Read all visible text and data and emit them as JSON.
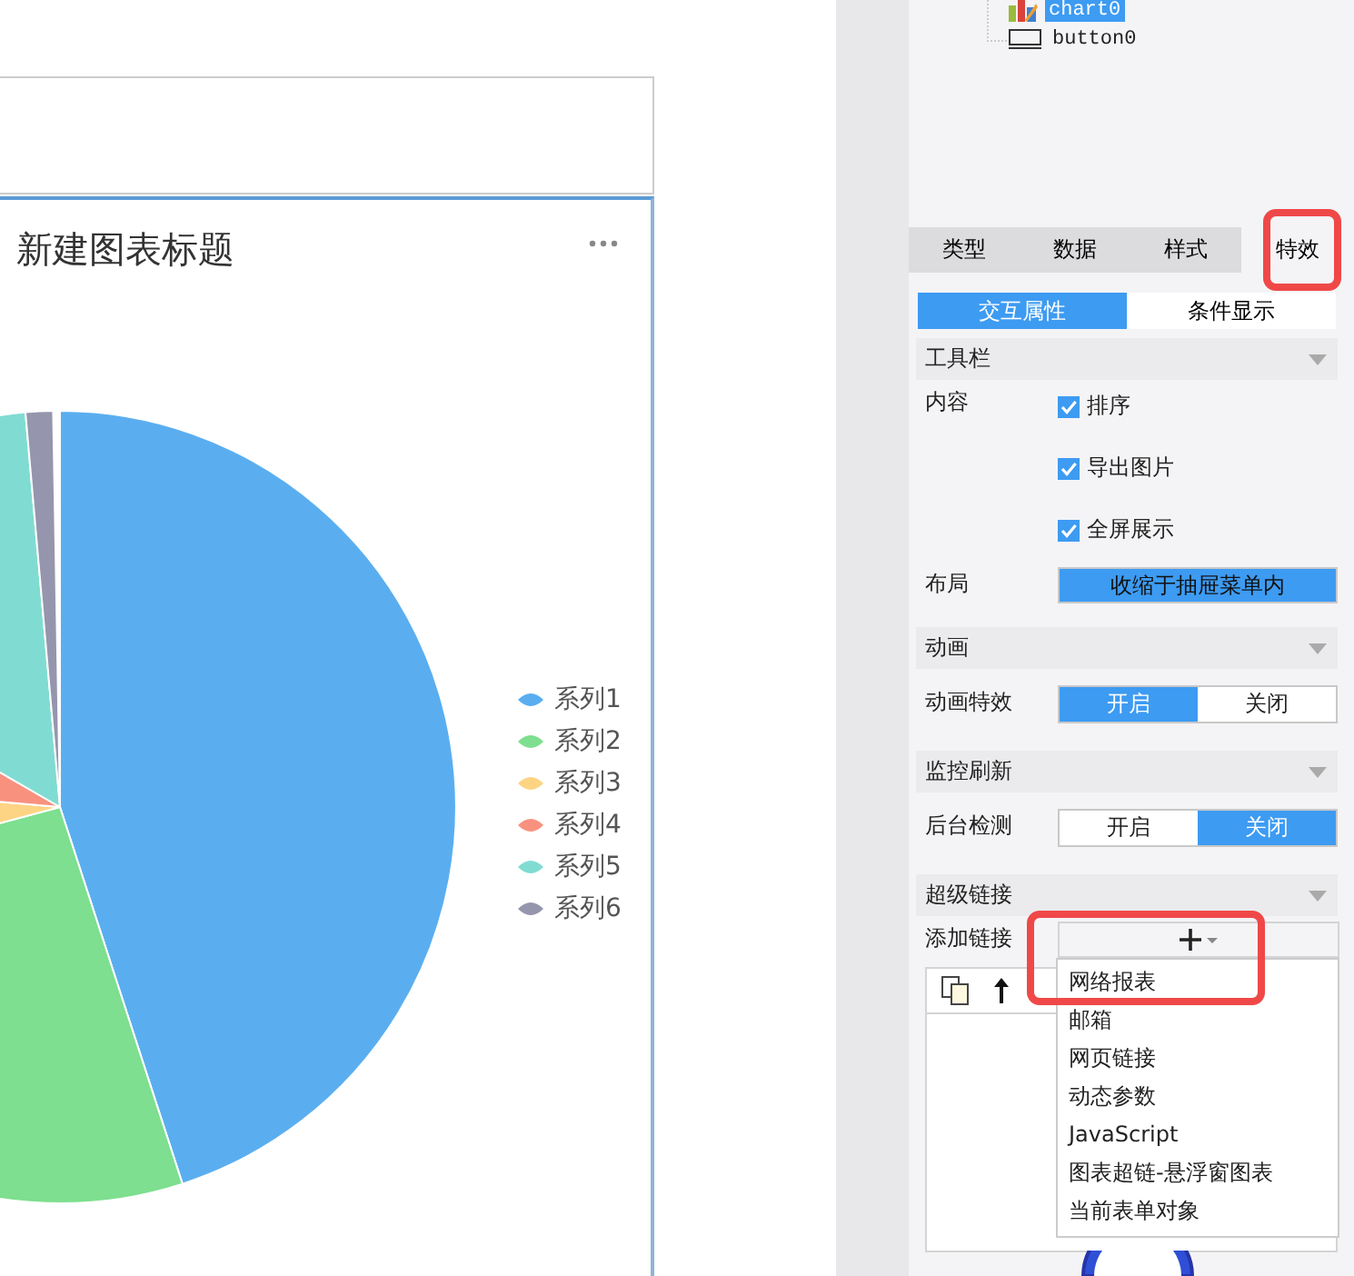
{
  "tree": [
    {
      "label": "chart0",
      "selected": true
    },
    {
      "label": "button0",
      "selected": false
    }
  ],
  "chart": {
    "title": "新建图表标题",
    "legend": [
      {
        "name": "系列1",
        "color": "#5aaef0"
      },
      {
        "name": "系列2",
        "color": "#7ddf8f"
      },
      {
        "name": "系列3",
        "color": "#fdd484"
      },
      {
        "name": "系列4",
        "color": "#f9917f"
      },
      {
        "name": "系列5",
        "color": "#80dcd2"
      },
      {
        "name": "系列6",
        "color": "#9595ad"
      }
    ]
  },
  "tabs": [
    {
      "label": "类型",
      "selected": false
    },
    {
      "label": "数据",
      "selected": false
    },
    {
      "label": "样式",
      "selected": false
    },
    {
      "label": "特效",
      "selected": true
    }
  ],
  "subtabs": [
    {
      "label": "交互属性",
      "selected": true
    },
    {
      "label": "条件显示",
      "selected": false
    }
  ],
  "sections": [
    {
      "title": "工具栏",
      "rows": [
        {
          "kind": "checks",
          "label": "内容",
          "options": [
            {
              "label": "排序",
              "checked": true
            },
            {
              "label": "导出图片",
              "checked": true
            },
            {
              "label": "全屏展示",
              "checked": true
            }
          ]
        },
        {
          "kind": "button",
          "label": "布局",
          "value": "收缩于抽屉菜单内"
        }
      ]
    },
    {
      "title": "动画",
      "rows": [
        {
          "kind": "toggle",
          "label": "动画特效",
          "options": [
            {
              "label": "开启",
              "selected": true
            },
            {
              "label": "关闭",
              "selected": false
            }
          ]
        }
      ]
    },
    {
      "title": "监控刷新",
      "rows": [
        {
          "kind": "toggle",
          "label": "后台检测",
          "options": [
            {
              "label": "开启",
              "selected": false
            },
            {
              "label": "关闭",
              "selected": true
            }
          ]
        }
      ]
    },
    {
      "title": "超级链接",
      "rows": [
        {
          "kind": "links",
          "label": "添加链接"
        }
      ]
    }
  ],
  "menu": [
    "网络报表",
    "邮箱",
    "网页链接",
    "动态参数",
    "JavaScript",
    "图表超链-悬浮窗图表",
    "当前表单对象"
  ]
}
